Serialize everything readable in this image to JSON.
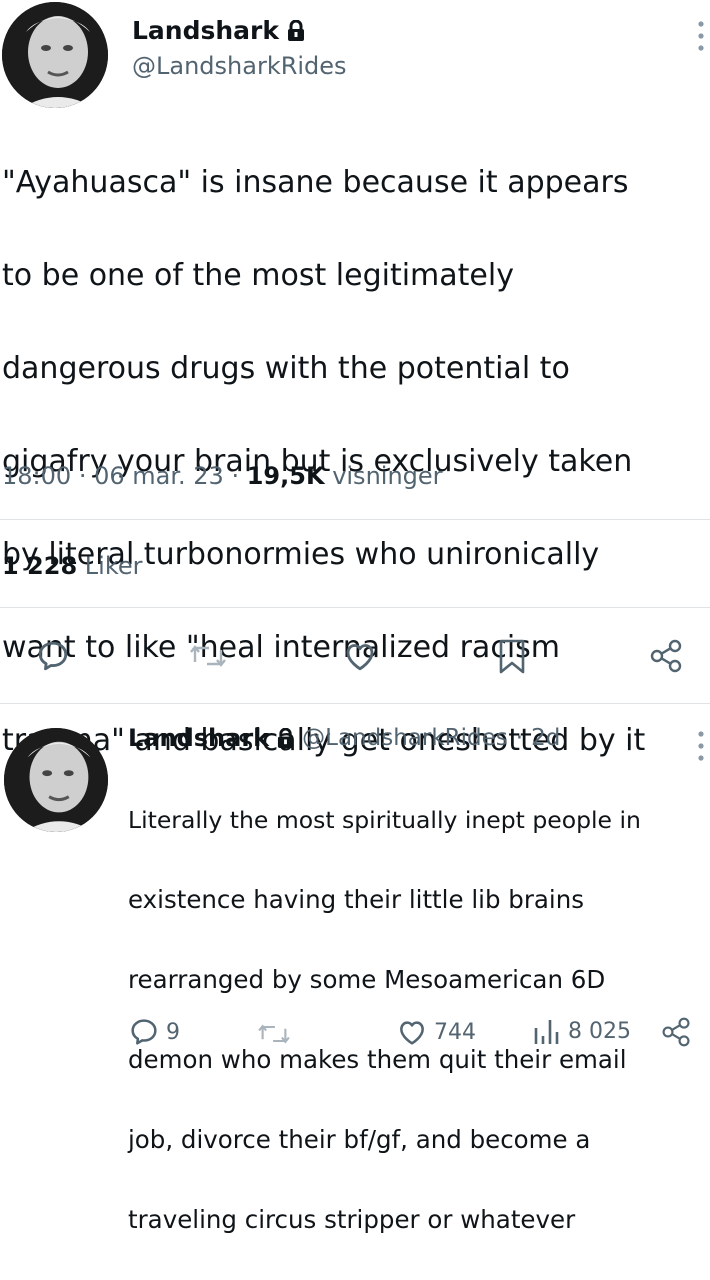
{
  "main_tweet": {
    "author_name": "Landshark",
    "author_handle": "@LandsharkRides",
    "lock_icon": "lock-icon",
    "text_lines": [
      "\"Ayahuasca\" is insane because it appears",
      "to be one of the most legitimately",
      "dangerous drugs with the potential to",
      "gigafry your brain but is exclusively taken",
      "by literal turbonormies who unironically",
      "want to like \"heal internalized racism",
      "trauma\" and basically get oneshotted by it"
    ],
    "time": "18:00",
    "date": "06 mar. 23",
    "views_count": "19,5K",
    "views_label": "visninger",
    "sep": "·",
    "likes_count": "1 228",
    "likes_label": "Liker"
  },
  "actions": {
    "icons": [
      "reply-icon",
      "retweet-icon",
      "like-icon",
      "bookmark-icon",
      "share-icon"
    ]
  },
  "reply_tweet": {
    "author_name": "Landshark",
    "author_handle": "@LandsharkRides",
    "age": "2d",
    "sep": "·",
    "text_lines": [
      "Literally the most spiritually inept people in",
      "existence having their little lib brains",
      "rearranged by some Mesoamerican 6D",
      "demon who makes them quit their email",
      "job, divorce their bf/gf, and become a",
      "traveling circus stripper or whatever"
    ],
    "reply_count": "9",
    "like_count": "744",
    "views_count": "8 025"
  },
  "colors": {
    "text": "#0f1419",
    "muted": "#536471",
    "divider": "#dfe3e6"
  }
}
